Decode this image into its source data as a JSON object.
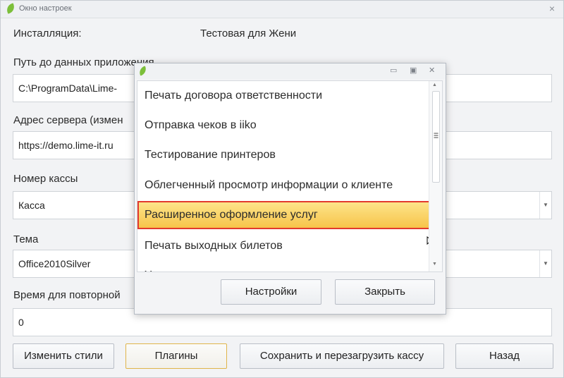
{
  "window": {
    "title": "Окно настроек",
    "close_icon": "×"
  },
  "settings": {
    "installation_label": "Инсталляция:",
    "installation_value": "Тестовая для Жени",
    "path_label": "Путь до данных приложения",
    "path_value": "C:\\ProgramData\\Lime-",
    "server_label": "Адрес сервера (измен",
    "server_value": "https://demo.lime-it.ru",
    "register_label": "Номер кассы",
    "register_value": "Касса",
    "theme_label": "Тема",
    "theme_value": "Office2010Silver",
    "retry_label": "Время для повторной",
    "retry_value": "0"
  },
  "buttons": {
    "change_styles": "Изменить стили",
    "plugins": "Плагины",
    "save_reload": "Сохранить и перезагрузить кассу",
    "back": "Назад"
  },
  "dialog": {
    "items": [
      "Печать договора ответственности",
      "Отправка чеков в iiko",
      "Тестирование принтеров",
      "Облегченный просмотр информации о клиенте",
      "Расширенное оформление услуг",
      "Печать выходных билетов",
      "У"
    ],
    "selected_index": 4,
    "settings_button": "Настройки",
    "close_button": "Закрыть"
  },
  "colors": {
    "selection_fill": "#f7c44a",
    "selection_border": "#e23a2e",
    "logo_green": "#7cbf3a"
  }
}
